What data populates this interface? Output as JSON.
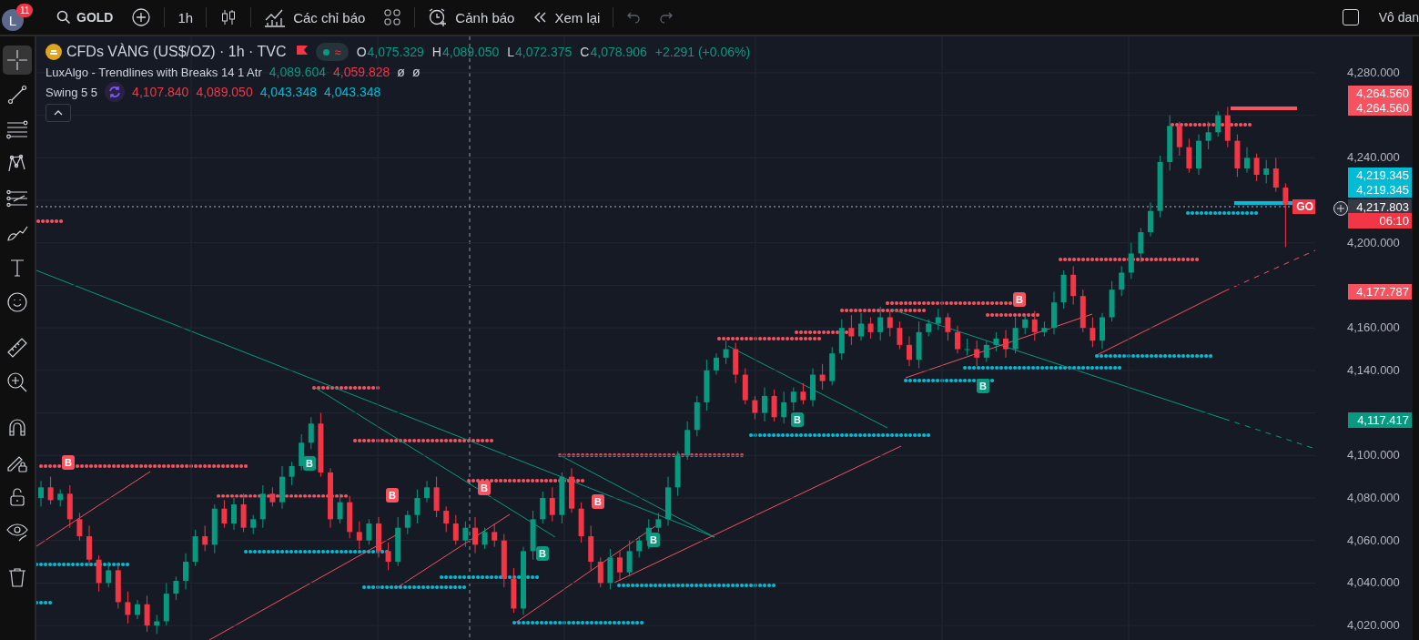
{
  "topbar": {
    "avatar": "L",
    "notifications": "11",
    "symbol": "GOLD",
    "interval": "1h",
    "indicators": "Các chỉ báo",
    "alerts": "Cảnh báo",
    "replay": "Xem lại",
    "checked": false,
    "right_label": "Vô dan"
  },
  "tools": [
    {
      "kind": "crosshair",
      "selected": true
    },
    {
      "kind": "trendline",
      "selected": false
    },
    {
      "kind": "hlines",
      "selected": false
    },
    {
      "kind": "pattern",
      "selected": false
    },
    {
      "kind": "fib",
      "selected": false
    },
    {
      "kind": "brush",
      "selected": false
    },
    {
      "kind": "text",
      "selected": false
    },
    {
      "kind": "smiley",
      "selected": false
    },
    {
      "kind": "ruler",
      "selected": false
    },
    {
      "kind": "zoom",
      "selected": false
    },
    {
      "kind": "magnet",
      "selected": false
    },
    {
      "kind": "pencil-lock",
      "selected": false
    },
    {
      "kind": "lock",
      "selected": false
    },
    {
      "kind": "eye",
      "selected": false
    },
    {
      "kind": "trash",
      "selected": false
    }
  ],
  "legend": {
    "title": "CFDs VÀNG (US$/OZ) · 1h · TVC",
    "approx": "≈",
    "ohlc": [
      {
        "label": "O",
        "value": "4,075.329"
      },
      {
        "label": "H",
        "value": "4,089.050"
      },
      {
        "label": "L",
        "value": "4,072.375"
      },
      {
        "label": "C",
        "value": "4,078.906"
      }
    ],
    "change": "+2.291 (+0.06%)",
    "indicators": [
      {
        "name": "LuxAlgo - Trendlines with Breaks 14 1 Atr",
        "icon": false,
        "values": [
          {
            "text": "4,089.604",
            "color": "#089981"
          },
          {
            "text": "4,059.828",
            "color": "#f23645"
          },
          {
            "text": "ø",
            "color": "#d1d4dc"
          },
          {
            "text": "ø",
            "color": "#d1d4dc"
          }
        ]
      },
      {
        "name": "Swing 5 5",
        "icon": true,
        "values": [
          {
            "text": "4,107.840",
            "color": "#f23645"
          },
          {
            "text": "4,089.050",
            "color": "#f23645"
          },
          {
            "text": "4,043.348",
            "color": "#00bcd4"
          },
          {
            "text": "4,043.348",
            "color": "#00bcd4"
          }
        ]
      }
    ]
  },
  "break_labels": [
    {
      "text": "B",
      "kind": "bear"
    },
    {
      "text": "B",
      "kind": "bull"
    },
    {
      "text": "B",
      "kind": "bear"
    },
    {
      "text": "B",
      "kind": "bear"
    },
    {
      "text": "B",
      "kind": "bull"
    },
    {
      "text": "B",
      "kind": "bear"
    },
    {
      "text": "B",
      "kind": "bull"
    },
    {
      "text": "B",
      "kind": "bull"
    },
    {
      "text": "B",
      "kind": "bull"
    },
    {
      "text": "B",
      "kind": "bear"
    }
  ],
  "symbol_tag": "GO",
  "chart_data": {
    "type": "candlestick",
    "grid": true,
    "ylim": [
      4013.2,
      4297.1
    ],
    "yticks": [
      {
        "value": 4280,
        "label": "4,280.000"
      },
      {
        "value": 4240,
        "label": "4,240.000"
      },
      {
        "value": 4200,
        "label": "4,200.000"
      },
      {
        "value": 4160,
        "label": "4,160.000"
      },
      {
        "value": 4140,
        "label": "4,140.000"
      },
      {
        "value": 4100,
        "label": "4,100.000"
      },
      {
        "value": 4080,
        "label": "4,080.000"
      },
      {
        "value": 4060,
        "label": "4,060.000"
      },
      {
        "value": 4040,
        "label": "4,040.000"
      },
      {
        "value": 4020,
        "label": "4,020.000"
      }
    ],
    "ohlc": [
      [
        4080,
        4088,
        4076,
        4085
      ],
      [
        4085,
        4090,
        4077,
        4079
      ],
      [
        4079,
        4084,
        4076,
        4082
      ],
      [
        4082,
        4086,
        4066,
        4070
      ],
      [
        4070,
        4073,
        4060,
        4062
      ],
      [
        4062,
        4067,
        4048,
        4051
      ],
      [
        4051,
        4053,
        4036,
        4040
      ],
      [
        4040,
        4050,
        4038,
        4046
      ],
      [
        4046,
        4049,
        4028,
        4031
      ],
      [
        4031,
        4036,
        4021,
        4025
      ],
      [
        4025,
        4032,
        4023,
        4030
      ],
      [
        4030,
        4034,
        4017,
        4020
      ],
      [
        4020,
        4025,
        4016,
        4022
      ],
      [
        4022,
        4040,
        4020,
        4035
      ],
      [
        4035,
        4043,
        4032,
        4041
      ],
      [
        4041,
        4054,
        4037,
        4050
      ],
      [
        4050,
        4065,
        4048,
        4062
      ],
      [
        4062,
        4067,
        4055,
        4058
      ],
      [
        4058,
        4077,
        4054,
        4075
      ],
      [
        4075,
        4079,
        4066,
        4068
      ],
      [
        4068,
        4080,
        4065,
        4077
      ],
      [
        4077,
        4082,
        4064,
        4066
      ],
      [
        4066,
        4072,
        4063,
        4070
      ],
      [
        4070,
        4086,
        4066,
        4082
      ],
      [
        4082,
        4085,
        4076,
        4078
      ],
      [
        4078,
        4095,
        4075,
        4090
      ],
      [
        4090,
        4097,
        4086,
        4095
      ],
      [
        4095,
        4110,
        4093,
        4106
      ],
      [
        4106,
        4118,
        4103,
        4115
      ],
      [
        4115,
        4120,
        4090,
        4092
      ],
      [
        4092,
        4094,
        4066,
        4070
      ],
      [
        4070,
        4082,
        4068,
        4078
      ],
      [
        4078,
        4081,
        4061,
        4064
      ],
      [
        4064,
        4069,
        4056,
        4060
      ],
      [
        4060,
        4070,
        4058,
        4068
      ],
      [
        4068,
        4071,
        4052,
        4055
      ],
      [
        4055,
        4059,
        4046,
        4050
      ],
      [
        4050,
        4071,
        4048,
        4066
      ],
      [
        4066,
        4074,
        4063,
        4072
      ],
      [
        4072,
        4084,
        4068,
        4080
      ],
      [
        4080,
        4088,
        4078,
        4085
      ],
      [
        4085,
        4090,
        4071,
        4074
      ],
      [
        4074,
        4076,
        4064,
        4068
      ],
      [
        4068,
        4072,
        4058,
        4060
      ],
      [
        4060,
        4069,
        4057,
        4066
      ],
      [
        4066,
        4071,
        4054,
        4058
      ],
      [
        4058,
        4066,
        4056,
        4064
      ],
      [
        4064,
        4068,
        4057,
        4060
      ],
      [
        4060,
        4063,
        4038,
        4042
      ],
      [
        4042,
        4047,
        4026,
        4028
      ],
      [
        4028,
        4057,
        4025,
        4055
      ],
      [
        4055,
        4074,
        4051,
        4070
      ],
      [
        4070,
        4083,
        4068,
        4080
      ],
      [
        4080,
        4085,
        4069,
        4072
      ],
      [
        4072,
        4092,
        4068,
        4090
      ],
      [
        4090,
        4094,
        4073,
        4075
      ],
      [
        4075,
        4078,
        4059,
        4062
      ],
      [
        4062,
        4067,
        4046,
        4050
      ],
      [
        4050,
        4052,
        4038,
        4040
      ],
      [
        4040,
        4056,
        4037,
        4052
      ],
      [
        4052,
        4055,
        4041,
        4045
      ],
      [
        4045,
        4060,
        4043,
        4055
      ],
      [
        4055,
        4062,
        4052,
        4060
      ],
      [
        4060,
        4070,
        4056,
        4066
      ],
      [
        4066,
        4073,
        4064,
        4070
      ],
      [
        4070,
        4090,
        4067,
        4085
      ],
      [
        4085,
        4102,
        4081,
        4100
      ],
      [
        4100,
        4116,
        4098,
        4112
      ],
      [
        4112,
        4128,
        4109,
        4125
      ],
      [
        4125,
        4145,
        4121,
        4140
      ],
      [
        4140,
        4148,
        4138,
        4146
      ],
      [
        4146,
        4154,
        4143,
        4150
      ],
      [
        4150,
        4153,
        4134,
        4138
      ],
      [
        4138,
        4141,
        4124,
        4126
      ],
      [
        4126,
        4128,
        4117,
        4120
      ],
      [
        4120,
        4132,
        4116,
        4128
      ],
      [
        4128,
        4131,
        4116,
        4118
      ],
      [
        4118,
        4130,
        4115,
        4125
      ],
      [
        4125,
        4132,
        4121,
        4130
      ],
      [
        4130,
        4134,
        4124,
        4126
      ],
      [
        4126,
        4141,
        4123,
        4138
      ],
      [
        4138,
        4143,
        4131,
        4135
      ],
      [
        4135,
        4151,
        4133,
        4148
      ],
      [
        4148,
        4164,
        4145,
        4160
      ],
      [
        4160,
        4166,
        4152,
        4156
      ],
      [
        4156,
        4167,
        4154,
        4162
      ],
      [
        4162,
        4165,
        4155,
        4158
      ],
      [
        4158,
        4170,
        4154,
        4165
      ],
      [
        4165,
        4168,
        4156,
        4160
      ],
      [
        4160,
        4163,
        4150,
        4152
      ],
      [
        4152,
        4156,
        4142,
        4145
      ],
      [
        4145,
        4163,
        4141,
        4158
      ],
      [
        4158,
        4164,
        4156,
        4162
      ],
      [
        4162,
        4169,
        4159,
        4165
      ],
      [
        4165,
        4167,
        4154,
        4158
      ],
      [
        4158,
        4161,
        4148,
        4150
      ],
      [
        4150,
        4155,
        4147,
        4150
      ],
      [
        4150,
        4154,
        4142,
        4146
      ],
      [
        4146,
        4154,
        4144,
        4152
      ],
      [
        4152,
        4158,
        4149,
        4155
      ],
      [
        4155,
        4159,
        4146,
        4150
      ],
      [
        4150,
        4165,
        4148,
        4160
      ],
      [
        4160,
        4166,
        4157,
        4164
      ],
      [
        4164,
        4168,
        4154,
        4158
      ],
      [
        4158,
        4163,
        4156,
        4160
      ],
      [
        4160,
        4177,
        4157,
        4172
      ],
      [
        4172,
        4187,
        4169,
        4185
      ],
      [
        4185,
        4189,
        4171,
        4175
      ],
      [
        4175,
        4178,
        4158,
        4160
      ],
      [
        4160,
        4165,
        4151,
        4154
      ],
      [
        4154,
        4167,
        4150,
        4165
      ],
      [
        4165,
        4182,
        4163,
        4178
      ],
      [
        4178,
        4189,
        4175,
        4186
      ],
      [
        4186,
        4200,
        4183,
        4195
      ],
      [
        4195,
        4207,
        4191,
        4205
      ],
      [
        4205,
        4219,
        4203,
        4215
      ],
      [
        4215,
        4241,
        4212,
        4238
      ],
      [
        4238,
        4260,
        4234,
        4255
      ],
      [
        4255,
        4257,
        4241,
        4245
      ],
      [
        4245,
        4249,
        4233,
        4235
      ],
      [
        4235,
        4251,
        4232,
        4248
      ],
      [
        4248,
        4257,
        4244,
        4252
      ],
      [
        4252,
        4262,
        4250,
        4260
      ],
      [
        4260,
        4264,
        4245,
        4248
      ],
      [
        4248,
        4251,
        4231,
        4235
      ],
      [
        4235,
        4245,
        4233,
        4240
      ],
      [
        4240,
        4242,
        4229,
        4232
      ],
      [
        4232,
        4239,
        4228,
        4235
      ],
      [
        4235,
        4240,
        4224,
        4226
      ],
      [
        4226,
        4228,
        4198,
        4218
      ]
    ]
  },
  "price_axis": {
    "badges": [
      {
        "text": "4,264.560",
        "color": "#f7525f"
      },
      {
        "text": "4,264.560",
        "color": "#f7525f"
      },
      {
        "text": "4,219.345",
        "color": "#00bcd4"
      },
      {
        "text": "4,219.345",
        "color": "#00bcd4"
      },
      {
        "text": "4,217.803",
        "color": "#363a45"
      },
      {
        "text": "06:10",
        "color": "#f23645"
      },
      {
        "text": "4,177.787",
        "color": "#f7525f"
      },
      {
        "text": "4,117.417",
        "color": "#089981"
      }
    ]
  }
}
